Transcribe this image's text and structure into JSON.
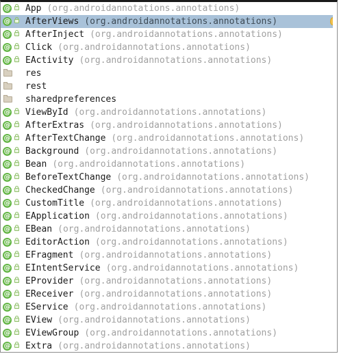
{
  "items": [
    {
      "name": "App",
      "pkg": "(org.androidannotations.annotations)",
      "icon": "annotation-icon"
    },
    {
      "name": "AfterViews",
      "pkg": "(org.androidannotations.annotations)",
      "icon": "annotation-icon",
      "selected": true
    },
    {
      "name": "AfterInject",
      "pkg": "(org.androidannotations.annotations)",
      "icon": "annotation-icon"
    },
    {
      "name": "Click",
      "pkg": "(org.androidannotations.annotations)",
      "icon": "annotation-icon"
    },
    {
      "name": "EActivity",
      "pkg": "(org.androidannotations.annotations)",
      "icon": "annotation-icon"
    },
    {
      "name": "res",
      "pkg": "",
      "icon": "package-folder-icon"
    },
    {
      "name": "rest",
      "pkg": "",
      "icon": "package-folder-icon"
    },
    {
      "name": "sharedpreferences",
      "pkg": "",
      "icon": "package-folder-icon"
    },
    {
      "name": "ViewById",
      "pkg": "(org.androidannotations.annotations)",
      "icon": "annotation-icon"
    },
    {
      "name": "AfterExtras",
      "pkg": "(org.androidannotations.annotations)",
      "icon": "annotation-icon"
    },
    {
      "name": "AfterTextChange",
      "pkg": "(org.androidannotations.annotations)",
      "icon": "annotation-icon"
    },
    {
      "name": "Background",
      "pkg": "(org.androidannotations.annotations)",
      "icon": "annotation-icon"
    },
    {
      "name": "Bean",
      "pkg": "(org.androidannotations.annotations)",
      "icon": "annotation-icon"
    },
    {
      "name": "BeforeTextChange",
      "pkg": "(org.androidannotations.annotations)",
      "icon": "annotation-icon"
    },
    {
      "name": "CheckedChange",
      "pkg": "(org.androidannotations.annotations)",
      "icon": "annotation-icon"
    },
    {
      "name": "CustomTitle",
      "pkg": "(org.androidannotations.annotations)",
      "icon": "annotation-icon"
    },
    {
      "name": "EApplication",
      "pkg": "(org.androidannotations.annotations)",
      "icon": "annotation-icon"
    },
    {
      "name": "EBean",
      "pkg": "(org.androidannotations.annotations)",
      "icon": "annotation-icon"
    },
    {
      "name": "EditorAction",
      "pkg": "(org.androidannotations.annotations)",
      "icon": "annotation-icon"
    },
    {
      "name": "EFragment",
      "pkg": "(org.androidannotations.annotations)",
      "icon": "annotation-icon"
    },
    {
      "name": "EIntentService",
      "pkg": "(org.androidannotations.annotations)",
      "icon": "annotation-icon"
    },
    {
      "name": "EProvider",
      "pkg": "(org.androidannotations.annotations)",
      "icon": "annotation-icon"
    },
    {
      "name": "EReceiver",
      "pkg": "(org.androidannotations.annotations)",
      "icon": "annotation-icon"
    },
    {
      "name": "EService",
      "pkg": "(org.androidannotations.annotations)",
      "icon": "annotation-icon"
    },
    {
      "name": "EView",
      "pkg": "(org.androidannotations.annotations)",
      "icon": "annotation-icon"
    },
    {
      "name": "EViewGroup",
      "pkg": "(org.androidannotations.annotations)",
      "icon": "annotation-icon"
    },
    {
      "name": "Extra",
      "pkg": "(org.androidannotations.annotations)",
      "icon": "annotation-icon"
    }
  ],
  "colors": {
    "selection": "#a9c2d9",
    "annotation_badge": "#62b543",
    "package_text": "#a0a0a0",
    "name_text": "#1a1a1a"
  },
  "glyphs": {
    "annotation": "@"
  }
}
